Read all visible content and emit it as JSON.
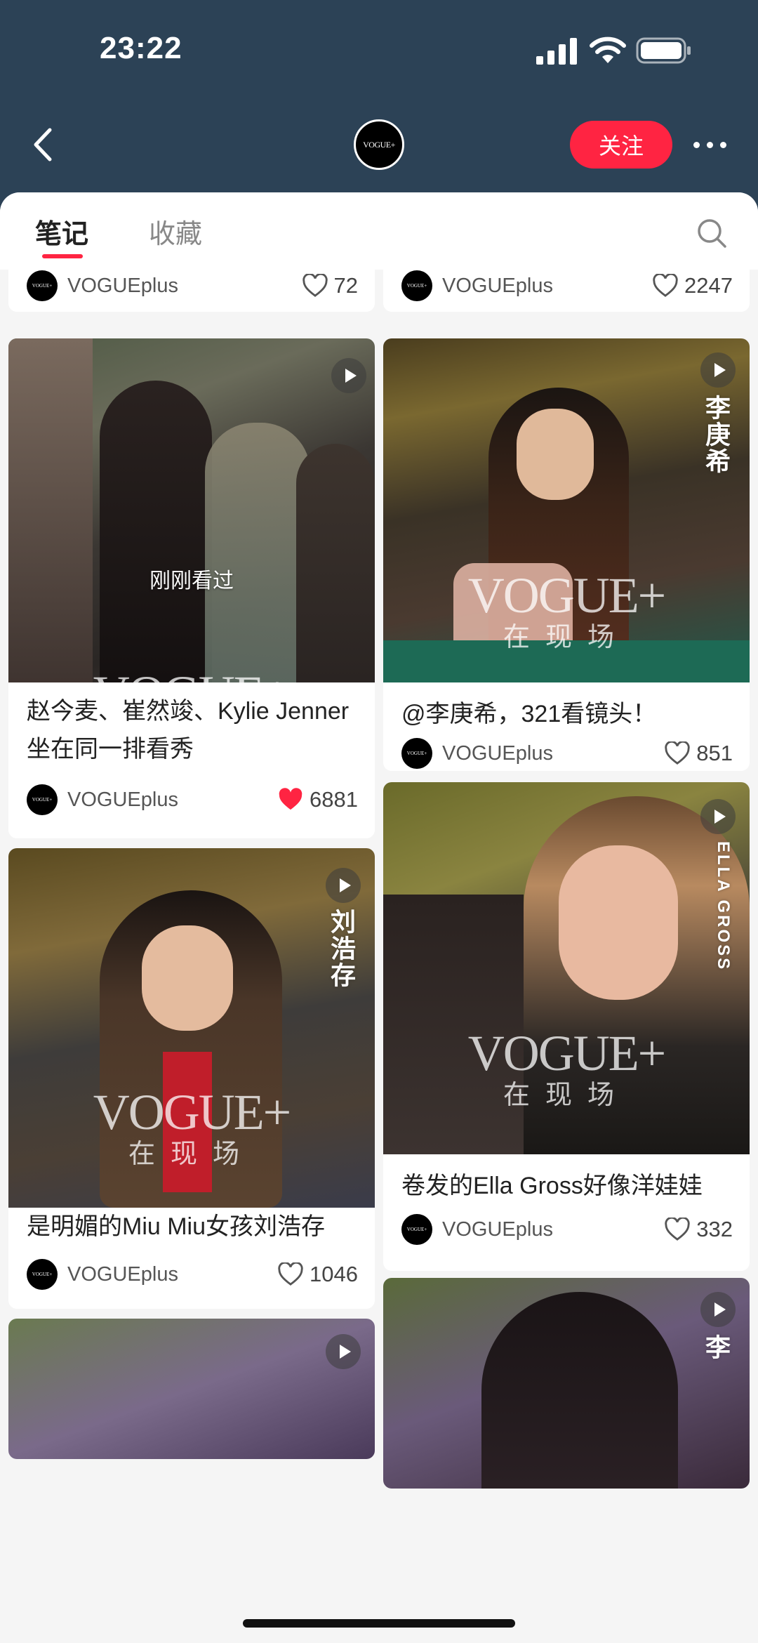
{
  "status_bar": {
    "time": "23:22"
  },
  "header": {
    "logo_text": "VOGUE+",
    "follow_label": "关注"
  },
  "tabs": [
    {
      "label": "笔记"
    },
    {
      "label": "收藏"
    }
  ],
  "colors": {
    "accent": "#ff2442",
    "header_bg": "#2c4256",
    "feed_bg": "#f5f5f5"
  },
  "watermark": {
    "logo": "VOGUE+",
    "sub": "在现场"
  },
  "recently_viewed": "刚刚看过",
  "cards": [
    {
      "title": "",
      "author": "VOGUEplus",
      "likes": "72",
      "liked": false
    },
    {
      "title": "",
      "author": "VOGUEplus",
      "likes": "2247",
      "liked": false
    },
    {
      "title": "赵今麦、崔然竣、Kylie Jenner坐在同一排看秀",
      "author": "VOGUEplus",
      "likes": "6881",
      "liked": true
    },
    {
      "title": "@李庚希，321看镜头！",
      "author": "VOGUEplus",
      "likes": "851",
      "liked": false,
      "overlay_name": "李庚希"
    },
    {
      "title": "是明媚的Miu Miu女孩刘浩存",
      "author": "VOGUEplus",
      "likes": "1046",
      "liked": false,
      "overlay_name": "刘浩存"
    },
    {
      "title": "卷发的Ella Gross好像洋娃娃",
      "author": "VOGUEplus",
      "likes": "332",
      "liked": false,
      "overlay_name": "ELLA GROSS"
    },
    {
      "title": "",
      "author": "",
      "likes": "",
      "liked": false,
      "overlay_name": "李"
    }
  ]
}
